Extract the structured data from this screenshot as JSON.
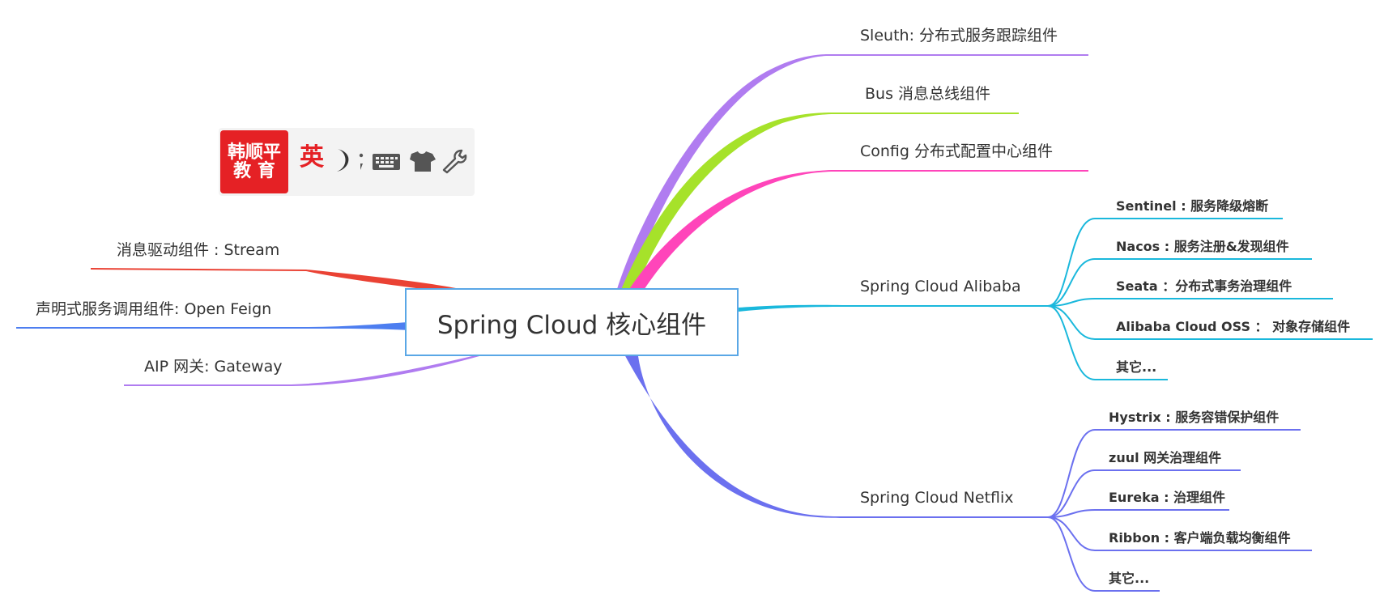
{
  "center": {
    "title": "Spring Cloud 核心组件"
  },
  "branches": {
    "sleuth": "Sleuth: 分布式服务跟踪组件",
    "bus": "Bus 消息总线组件",
    "config": "Config 分布式配置中心组件",
    "alibaba": "Spring Cloud Alibaba",
    "netflix": "Spring Cloud Netflix",
    "stream": "消息驱动组件 : Stream",
    "feign": "声明式服务调用组件: Open Feign",
    "gateway": "AIP 网关: Gateway"
  },
  "alibaba_children": [
    "Sentinel : 服务降级熔断",
    "Nacos : 服务注册&发现组件",
    "Seata ：分布式事务治理组件",
    "Alibaba Cloud OSS ：  对象存储组件",
    "其它..."
  ],
  "netflix_children": [
    "Hystrix : 服务容错保护组件",
    "zuul 网关治理组件",
    "Eureka : 治理组件",
    "Ribbon : 客户端负载均衡组件",
    "其它..."
  ],
  "ime": {
    "logo_line1": "韩顺平",
    "logo_line2": "教 育",
    "language": "英"
  },
  "icons": [
    "moon-icon",
    "punctuation-icon",
    "keyboard-icon",
    "tshirt-skin-icon",
    "wrench-icon"
  ],
  "colors": {
    "sleuth": "#b07cf0",
    "bus": "#a6e22a",
    "config": "#ff45ba",
    "alibaba": "#1ab8dc",
    "netflix": "#6b70ef",
    "stream": "#ea4234",
    "feign": "#4d7ef0",
    "gateway": "#b07cf0",
    "center_border": "#5aa7e6",
    "ime_red": "#e52125"
  }
}
